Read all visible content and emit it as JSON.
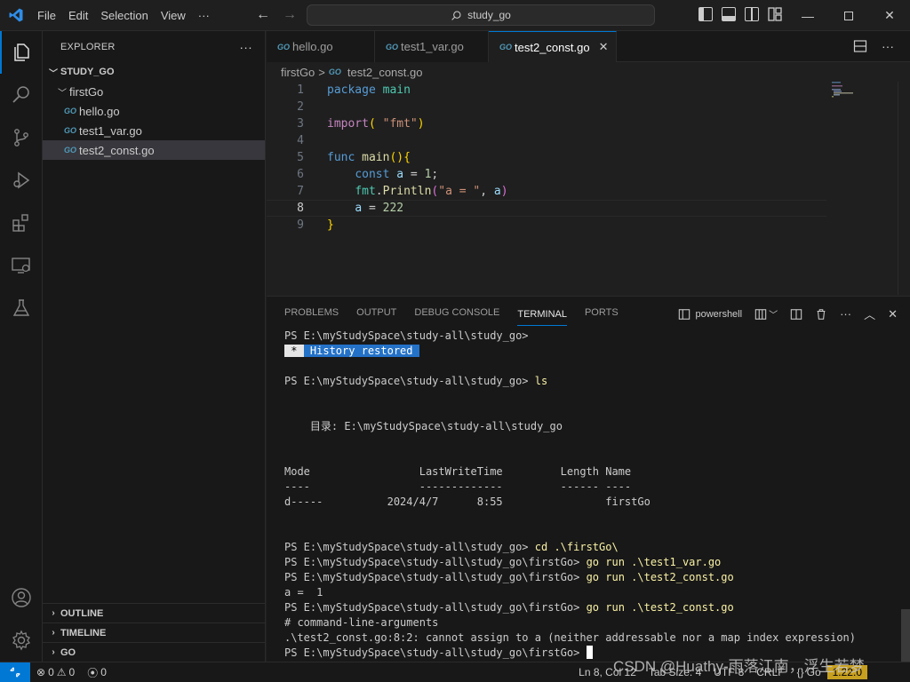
{
  "titlebar": {
    "menu": [
      "File",
      "Edit",
      "Selection",
      "View"
    ],
    "more": "···",
    "search": "study_go"
  },
  "explorer": {
    "header": "EXPLORER",
    "more": "···",
    "root": "STUDY_GO",
    "folder": "firstGo",
    "files": [
      "hello.go",
      "test1_var.go",
      "test2_const.go"
    ],
    "sections": [
      "OUTLINE",
      "TIMELINE",
      "GO"
    ]
  },
  "tabs": [
    {
      "label": "hello.go"
    },
    {
      "label": "test1_var.go"
    },
    {
      "label": "test2_const.go",
      "close": "✕"
    }
  ],
  "breadcrumb": {
    "folder": "firstGo",
    "sep": ">",
    "file": "test2_const.go"
  },
  "editor": {
    "line_numbers": [
      "1",
      "2",
      "3",
      "4",
      "5",
      "6",
      "7",
      "8",
      "9"
    ],
    "current_line": "8"
  },
  "panel": {
    "tabs": [
      "PROBLEMS",
      "OUTPUT",
      "DEBUG CONSOLE",
      "TERMINAL",
      "PORTS"
    ],
    "active_tab": "TERMINAL",
    "shell": "powershell",
    "terminal": {
      "prompt1": "PS E:\\myStudySpace\\study-all\\study_go>",
      "history_star": " * ",
      "history_text": " History restored ",
      "prompt2": "PS E:\\myStudySpace\\study-all\\study_go>",
      "cmd_ls": " ls",
      "dir_line": "    目录: E:\\myStudySpace\\study-all\\study_go",
      "header": "Mode                 LastWriteTime         Length Name",
      "underline": "----                 -------------         ------ ----",
      "row": "d-----          2024/4/7      8:55                firstGo",
      "prompt3": "PS E:\\myStudySpace\\study-all\\study_go>",
      "cmd_cd": " cd .\\firstGo\\",
      "prompt4": "PS E:\\myStudySpace\\study-all\\study_go\\firstGo>",
      "cmd_run1": " go run .\\test1_var.go",
      "prompt5": "PS E:\\myStudySpace\\study-all\\study_go\\firstGo>",
      "cmd_run2": " go run .\\test2_const.go",
      "out1": "a =  1",
      "prompt6": "PS E:\\myStudySpace\\study-all\\study_go\\firstGo>",
      "cmd_run3": " go run .\\test2_const.go",
      "err1": "# command-line-arguments",
      "err2": ".\\test2_const.go:8:2: cannot assign to a (neither addressable nor a map index expression)",
      "prompt7": "PS E:\\myStudySpace\\study-all\\study_go\\firstGo> "
    }
  },
  "statusbar": {
    "errors": "0",
    "warnings": "0",
    "ports": "0",
    "position": "Ln 8, Col 12",
    "tab_size": "Tab Size: 4",
    "encoding": "UTF-8",
    "eol": "CRLF",
    "language": "Go",
    "go_version": "1.22.0"
  },
  "watermark": "CSDN @Huathy-雨落江南，浮生若梦",
  "colors": {
    "accent": "#0078d4",
    "go_version_bg": "#c8a020"
  }
}
